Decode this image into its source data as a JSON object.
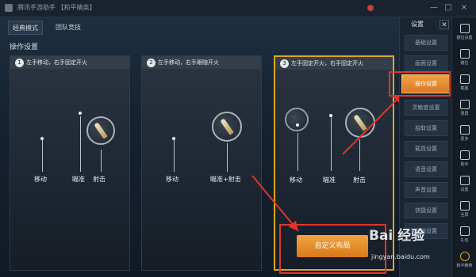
{
  "window": {
    "title": "腾讯手游助手  【和平精英】",
    "close": "×",
    "minimize": "—",
    "maximize": "□"
  },
  "tabs": [
    {
      "label": "经典模式"
    },
    {
      "label": "团队竞技"
    }
  ],
  "section_title": "操作设置",
  "panels": [
    {
      "num": "1",
      "header": "左手移动，右手固定开火",
      "labels": [
        "移动",
        "瞄准",
        "射击"
      ]
    },
    {
      "num": "2",
      "header": "左手移动，右手跟随开火",
      "labels": [
        "移动",
        "瞄准+射击"
      ]
    },
    {
      "num": "3",
      "header": "左手固定开火，右手固定开火",
      "labels": [
        "移动",
        "瞄准",
        "射击"
      ]
    }
  ],
  "custom_layout_button": "自定义布局",
  "settings_panel": {
    "header": "设置",
    "close": "✕",
    "items": [
      {
        "label": "基础设置"
      },
      {
        "label": "画面设置"
      },
      {
        "label": "操作设置"
      },
      {
        "label": "灵敏度设置"
      },
      {
        "label": "拾取设置"
      },
      {
        "label": "载具设置"
      },
      {
        "label": "语音设置"
      },
      {
        "label": "声音设置"
      },
      {
        "label": "快捷设置"
      },
      {
        "label": "其他设置"
      }
    ]
  },
  "toolbar": [
    {
      "label": "键位设置"
    },
    {
      "label": "键位"
    },
    {
      "label": "截图"
    },
    {
      "label": "录屏"
    },
    {
      "label": "更多"
    },
    {
      "label": "助手"
    },
    {
      "label": "设置"
    },
    {
      "label": "全屏"
    },
    {
      "label": "礼包"
    },
    {
      "label": "和平精英"
    }
  ],
  "watermark": {
    "text": "Bai 经验",
    "url": "jingyan.baidu.com"
  },
  "colors": {
    "accent_orange": "#e8902f",
    "highlight_red": "#e0342b",
    "selected_gold": "#d9a820"
  }
}
